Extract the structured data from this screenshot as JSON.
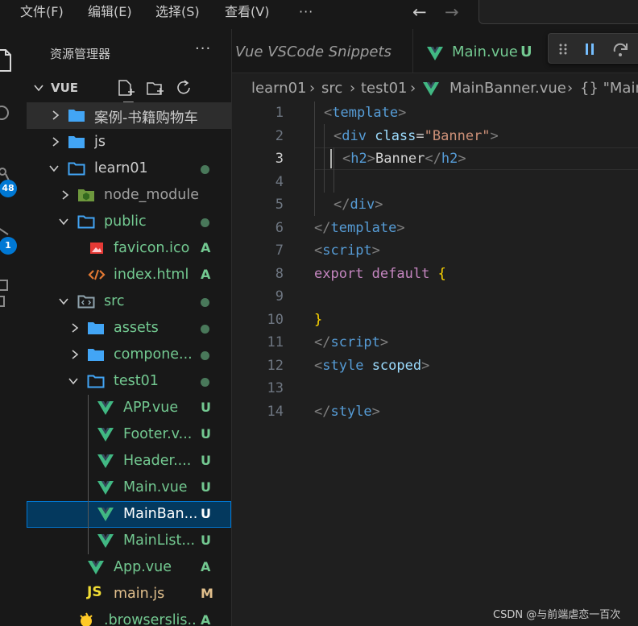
{
  "menu": {
    "items": [
      "文件(F)",
      "编辑(E)",
      "选择(S)",
      "查看(V)"
    ],
    "more": "···"
  },
  "activity": {
    "badges": [
      "48",
      "1"
    ]
  },
  "sidebar": {
    "title": "资源管理器",
    "more": "···",
    "section": "VUE"
  },
  "tree": [
    {
      "label": "案例-书籍购物车",
      "kind": "folder",
      "chevron": "right",
      "status": ""
    },
    {
      "label": "js",
      "kind": "folder",
      "chevron": "right",
      "status": ""
    },
    {
      "label": "learn01",
      "kind": "folder-open",
      "chevron": "down",
      "status": "dot"
    },
    {
      "label": "node_modules",
      "kind": "folder-node",
      "chevron": "right",
      "status": ""
    },
    {
      "label": "public",
      "kind": "folder-open",
      "chevron": "down",
      "status": "dot"
    },
    {
      "label": "favicon.ico",
      "kind": "image",
      "status": "A"
    },
    {
      "label": "index.html",
      "kind": "html",
      "status": "A"
    },
    {
      "label": "src",
      "kind": "folder-src",
      "chevron": "down",
      "status": "dot"
    },
    {
      "label": "assets",
      "kind": "folder",
      "chevron": "right",
      "status": "dot"
    },
    {
      "label": "compone...",
      "kind": "folder",
      "chevron": "right",
      "status": "dot"
    },
    {
      "label": "test01",
      "kind": "folder-open",
      "chevron": "down",
      "status": "dot"
    },
    {
      "label": "APP.vue",
      "kind": "vue",
      "status": "U"
    },
    {
      "label": "Footer.v...",
      "kind": "vue",
      "status": "U"
    },
    {
      "label": "Header....",
      "kind": "vue",
      "status": "U"
    },
    {
      "label": "Main.vue",
      "kind": "vue",
      "status": "U"
    },
    {
      "label": "MainBan...",
      "kind": "vue",
      "status": "U"
    },
    {
      "label": "MainList...",
      "kind": "vue",
      "status": "U"
    },
    {
      "label": "App.vue",
      "kind": "vue",
      "status": "A"
    },
    {
      "label": "main.js",
      "kind": "js",
      "status": "M"
    },
    {
      "label": ".browserslis...",
      "kind": "config",
      "status": "A"
    }
  ],
  "tabs": [
    {
      "label": "Vue VSCode Snippets",
      "italic": true
    },
    {
      "label": "Main.vue",
      "status": "U"
    }
  ],
  "breadcrumb": [
    "learn01",
    "src",
    "test01",
    "MainBanner.vue",
    "{} \"Main"
  ],
  "editor": {
    "line_numbers": [
      "1",
      "2",
      "3",
      "4",
      "5",
      "6",
      "7",
      "8",
      "9",
      "10",
      "11",
      "12",
      "13",
      "14"
    ],
    "current_line": "3"
  },
  "code": {
    "l1_tag": "template",
    "l2_tag": "div",
    "l2_attr": "class",
    "l2_val": "\"Banner\"",
    "l3_tag": "h2",
    "l3_text": "Banner",
    "l5_tag": "div",
    "l6_tag": "template",
    "l7_tag": "script",
    "l8_kw1": "export",
    "l8_kw2": "default",
    "l8_brace": "{",
    "l10_brace": "}",
    "l11_tag": "script",
    "l12_tag": "style",
    "l12_attr": "scoped",
    "l14_tag": "style"
  },
  "watermark": "CSDN @与前端虐恋一百次",
  "colors": {
    "vue": "#41b883",
    "folder": "#42a5f5",
    "untracked": "#73c991",
    "added": "#73c991",
    "modified": "#e2c08d",
    "accent": "#0078d4"
  }
}
